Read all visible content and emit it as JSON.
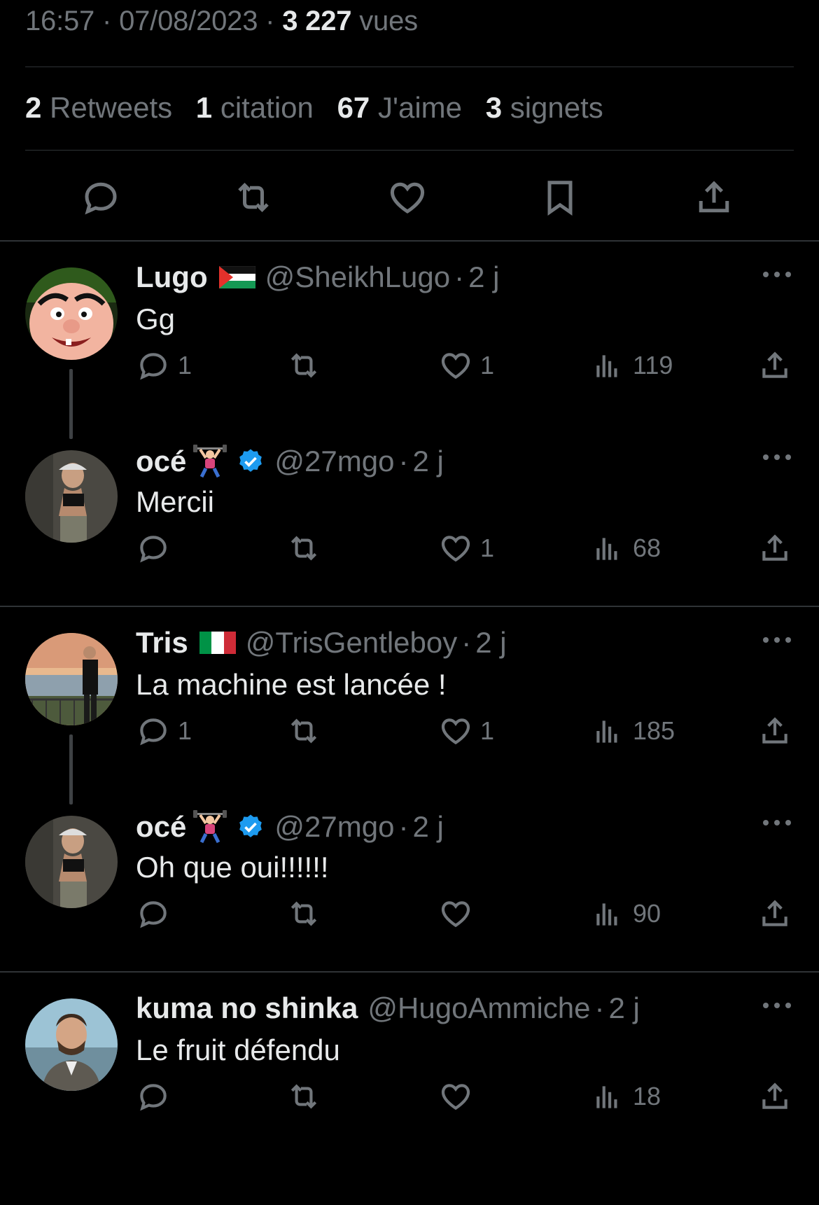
{
  "tweet": {
    "time": "16:57",
    "date": "07/08/2023",
    "views_count": "3 227",
    "views_label": "vues"
  },
  "stats": {
    "retweets_count": "2",
    "retweets_label": "Retweets",
    "quotes_count": "1",
    "quotes_label": "citation",
    "likes_count": "67",
    "likes_label": "J'aime",
    "bookmarks_count": "3",
    "bookmarks_label": "signets"
  },
  "actions": [
    "reply-icon",
    "retweet-icon",
    "heart-icon",
    "bookmark-icon",
    "share-icon"
  ],
  "replies": [
    {
      "name": "Lugo",
      "handle": "@SheikhLugo",
      "age": "2 j",
      "text": "Gg",
      "reply_count": "1",
      "retweet_count": "",
      "like_count": "1",
      "views": "119",
      "flag": "palestine",
      "verified": false
    },
    {
      "name": "océ",
      "handle": "@27mgo",
      "age": "2 j",
      "text": "Mercii",
      "reply_count": "",
      "retweet_count": "",
      "like_count": "1",
      "views": "68",
      "emoji": "weightlifter",
      "verified": true
    },
    {
      "name": "Tris",
      "handle": "@TrisGentleboy",
      "age": "2 j",
      "text": "La machine est lancée !",
      "reply_count": "1",
      "retweet_count": "",
      "like_count": "1",
      "views": "185",
      "flag": "italy",
      "verified": false
    },
    {
      "name": "océ",
      "handle": "@27mgo",
      "age": "2 j",
      "text": "Oh que oui!!!!!!",
      "reply_count": "",
      "retweet_count": "",
      "like_count": "",
      "views": "90",
      "emoji": "weightlifter",
      "verified": true
    },
    {
      "name": "kuma no shinka",
      "handle": "@HugoAmmiche",
      "age": "2 j",
      "text": "Le fruit défendu",
      "reply_count": "",
      "retweet_count": "",
      "like_count": "",
      "views": "18",
      "verified": false
    }
  ],
  "colors": {
    "background": "#000000",
    "text": "#e7e9ea",
    "muted": "#71767b",
    "divider": "#2f3336",
    "verified": "#1d9bf0"
  }
}
